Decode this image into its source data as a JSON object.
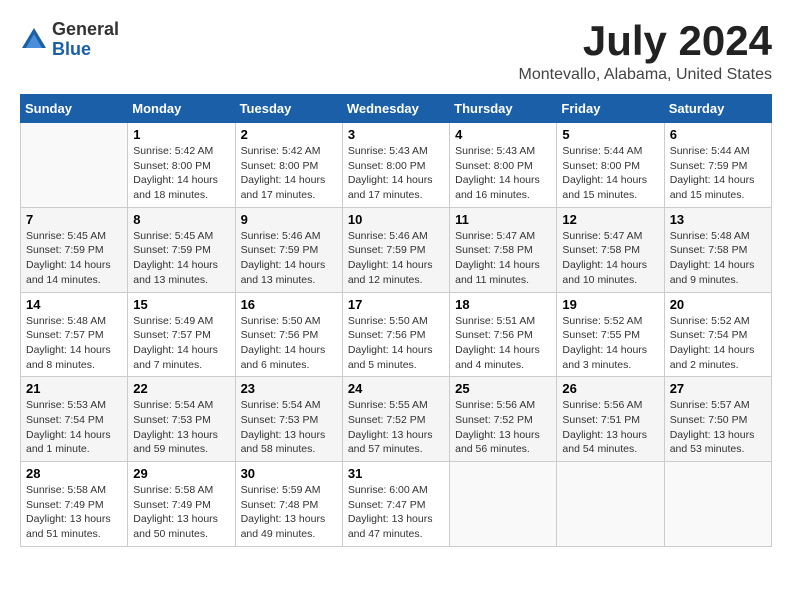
{
  "header": {
    "logo": {
      "general": "General",
      "blue": "Blue"
    },
    "title": "July 2024",
    "location": "Montevallo, Alabama, United States"
  },
  "days_of_week": [
    "Sunday",
    "Monday",
    "Tuesday",
    "Wednesday",
    "Thursday",
    "Friday",
    "Saturday"
  ],
  "weeks": [
    [
      {
        "day": "",
        "info": ""
      },
      {
        "day": "1",
        "info": "Sunrise: 5:42 AM\nSunset: 8:00 PM\nDaylight: 14 hours\nand 18 minutes."
      },
      {
        "day": "2",
        "info": "Sunrise: 5:42 AM\nSunset: 8:00 PM\nDaylight: 14 hours\nand 17 minutes."
      },
      {
        "day": "3",
        "info": "Sunrise: 5:43 AM\nSunset: 8:00 PM\nDaylight: 14 hours\nand 17 minutes."
      },
      {
        "day": "4",
        "info": "Sunrise: 5:43 AM\nSunset: 8:00 PM\nDaylight: 14 hours\nand 16 minutes."
      },
      {
        "day": "5",
        "info": "Sunrise: 5:44 AM\nSunset: 8:00 PM\nDaylight: 14 hours\nand 15 minutes."
      },
      {
        "day": "6",
        "info": "Sunrise: 5:44 AM\nSunset: 7:59 PM\nDaylight: 14 hours\nand 15 minutes."
      }
    ],
    [
      {
        "day": "7",
        "info": "Sunrise: 5:45 AM\nSunset: 7:59 PM\nDaylight: 14 hours\nand 14 minutes."
      },
      {
        "day": "8",
        "info": "Sunrise: 5:45 AM\nSunset: 7:59 PM\nDaylight: 14 hours\nand 13 minutes."
      },
      {
        "day": "9",
        "info": "Sunrise: 5:46 AM\nSunset: 7:59 PM\nDaylight: 14 hours\nand 13 minutes."
      },
      {
        "day": "10",
        "info": "Sunrise: 5:46 AM\nSunset: 7:59 PM\nDaylight: 14 hours\nand 12 minutes."
      },
      {
        "day": "11",
        "info": "Sunrise: 5:47 AM\nSunset: 7:58 PM\nDaylight: 14 hours\nand 11 minutes."
      },
      {
        "day": "12",
        "info": "Sunrise: 5:47 AM\nSunset: 7:58 PM\nDaylight: 14 hours\nand 10 minutes."
      },
      {
        "day": "13",
        "info": "Sunrise: 5:48 AM\nSunset: 7:58 PM\nDaylight: 14 hours\nand 9 minutes."
      }
    ],
    [
      {
        "day": "14",
        "info": "Sunrise: 5:48 AM\nSunset: 7:57 PM\nDaylight: 14 hours\nand 8 minutes."
      },
      {
        "day": "15",
        "info": "Sunrise: 5:49 AM\nSunset: 7:57 PM\nDaylight: 14 hours\nand 7 minutes."
      },
      {
        "day": "16",
        "info": "Sunrise: 5:50 AM\nSunset: 7:56 PM\nDaylight: 14 hours\nand 6 minutes."
      },
      {
        "day": "17",
        "info": "Sunrise: 5:50 AM\nSunset: 7:56 PM\nDaylight: 14 hours\nand 5 minutes."
      },
      {
        "day": "18",
        "info": "Sunrise: 5:51 AM\nSunset: 7:56 PM\nDaylight: 14 hours\nand 4 minutes."
      },
      {
        "day": "19",
        "info": "Sunrise: 5:52 AM\nSunset: 7:55 PM\nDaylight: 14 hours\nand 3 minutes."
      },
      {
        "day": "20",
        "info": "Sunrise: 5:52 AM\nSunset: 7:54 PM\nDaylight: 14 hours\nand 2 minutes."
      }
    ],
    [
      {
        "day": "21",
        "info": "Sunrise: 5:53 AM\nSunset: 7:54 PM\nDaylight: 14 hours\nand 1 minute."
      },
      {
        "day": "22",
        "info": "Sunrise: 5:54 AM\nSunset: 7:53 PM\nDaylight: 13 hours\nand 59 minutes."
      },
      {
        "day": "23",
        "info": "Sunrise: 5:54 AM\nSunset: 7:53 PM\nDaylight: 13 hours\nand 58 minutes."
      },
      {
        "day": "24",
        "info": "Sunrise: 5:55 AM\nSunset: 7:52 PM\nDaylight: 13 hours\nand 57 minutes."
      },
      {
        "day": "25",
        "info": "Sunrise: 5:56 AM\nSunset: 7:52 PM\nDaylight: 13 hours\nand 56 minutes."
      },
      {
        "day": "26",
        "info": "Sunrise: 5:56 AM\nSunset: 7:51 PM\nDaylight: 13 hours\nand 54 minutes."
      },
      {
        "day": "27",
        "info": "Sunrise: 5:57 AM\nSunset: 7:50 PM\nDaylight: 13 hours\nand 53 minutes."
      }
    ],
    [
      {
        "day": "28",
        "info": "Sunrise: 5:58 AM\nSunset: 7:49 PM\nDaylight: 13 hours\nand 51 minutes."
      },
      {
        "day": "29",
        "info": "Sunrise: 5:58 AM\nSunset: 7:49 PM\nDaylight: 13 hours\nand 50 minutes."
      },
      {
        "day": "30",
        "info": "Sunrise: 5:59 AM\nSunset: 7:48 PM\nDaylight: 13 hours\nand 49 minutes."
      },
      {
        "day": "31",
        "info": "Sunrise: 6:00 AM\nSunset: 7:47 PM\nDaylight: 13 hours\nand 47 minutes."
      },
      {
        "day": "",
        "info": ""
      },
      {
        "day": "",
        "info": ""
      },
      {
        "day": "",
        "info": ""
      }
    ]
  ]
}
